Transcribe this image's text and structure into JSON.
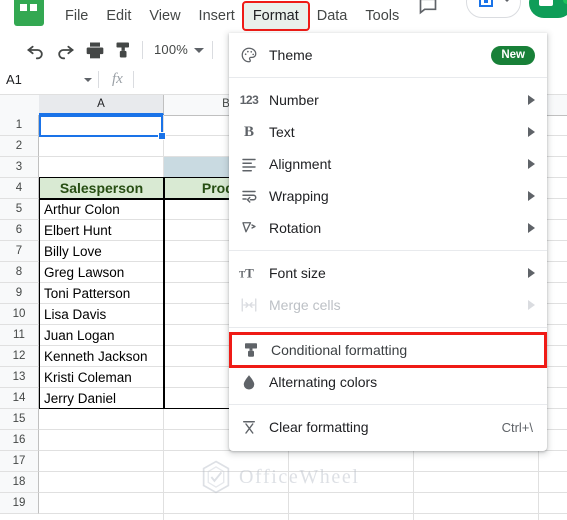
{
  "app": {
    "logo_icon": "sheets-logo-icon",
    "menubar": [
      {
        "label": "File"
      },
      {
        "label": "Edit"
      },
      {
        "label": "View"
      },
      {
        "label": "Insert"
      },
      {
        "label": "Format"
      },
      {
        "label": "Data"
      },
      {
        "label": "Tools"
      }
    ],
    "active_menu": "Format"
  },
  "topright": {
    "comment_icon": "comment-icon",
    "present_icon": "present-icon",
    "present_caret_icon": "chevron-down-icon",
    "share_icon": "share-lock-icon"
  },
  "toolbar": {
    "undo_icon": "undo-icon",
    "redo_icon": "redo-icon",
    "print_icon": "print-icon",
    "paint_format_icon": "paint-format-icon",
    "zoom_value": "100%",
    "zoom_caret_icon": "chevron-down-icon"
  },
  "formulabar": {
    "name_box_value": "A1",
    "name_box_caret_icon": "chevron-down-icon",
    "fx_label": "fx",
    "formula_value": ""
  },
  "grid": {
    "columns": [
      {
        "label": "A",
        "selected": true
      },
      {
        "label": "B",
        "selected": false
      }
    ],
    "rows": [
      "1",
      "2",
      "3",
      "4",
      "5",
      "6",
      "7",
      "8",
      "9",
      "10",
      "11",
      "12",
      "13",
      "14",
      "15",
      "16",
      "17",
      "18",
      "19"
    ],
    "header_a": "Salesperson",
    "header_b": "Produc",
    "names": [
      "Arthur Colon",
      "Elbert Hunt",
      "Billy Love",
      "Greg Lawson",
      "Toni Patterson",
      "Lisa Davis",
      "Juan Logan",
      "Kenneth Jackson",
      "Kristi Coleman",
      "Jerry Daniel"
    ],
    "selected_cell": "A1"
  },
  "format_menu": {
    "items": [
      {
        "icon": "palette-icon",
        "label": "Theme",
        "badge": "New",
        "submenu": false,
        "accel": "",
        "disabled": false,
        "highlighted": false
      },
      {
        "icon": "number-123-icon",
        "label": "Number",
        "badge": "",
        "submenu": true,
        "accel": "",
        "disabled": false,
        "highlighted": false
      },
      {
        "icon": "bold-text-icon",
        "label": "Text",
        "badge": "",
        "submenu": true,
        "accel": "",
        "disabled": false,
        "highlighted": false
      },
      {
        "icon": "alignment-icon",
        "label": "Alignment",
        "badge": "",
        "submenu": true,
        "accel": "",
        "disabled": false,
        "highlighted": false
      },
      {
        "icon": "wrapping-icon",
        "label": "Wrapping",
        "badge": "",
        "submenu": true,
        "accel": "",
        "disabled": false,
        "highlighted": false
      },
      {
        "icon": "rotation-icon",
        "label": "Rotation",
        "badge": "",
        "submenu": true,
        "accel": "",
        "disabled": false,
        "highlighted": false
      },
      {
        "icon": "font-size-icon",
        "label": "Font size",
        "badge": "",
        "submenu": true,
        "accel": "",
        "disabled": false,
        "highlighted": false
      },
      {
        "icon": "merge-cells-icon",
        "label": "Merge cells",
        "badge": "",
        "submenu": true,
        "accel": "",
        "disabled": true,
        "highlighted": false
      },
      {
        "icon": "conditional-formatting-icon",
        "label": "Conditional formatting",
        "badge": "",
        "submenu": false,
        "accel": "",
        "disabled": false,
        "highlighted": true
      },
      {
        "icon": "alternating-colors-icon",
        "label": "Alternating colors",
        "badge": "",
        "submenu": false,
        "accel": "",
        "disabled": false,
        "highlighted": false
      },
      {
        "icon": "clear-formatting-icon",
        "label": "Clear formatting",
        "badge": "",
        "submenu": false,
        "accel": "Ctrl+\\",
        "disabled": false,
        "highlighted": false
      }
    ]
  },
  "watermark": {
    "text": "OfficeWheel",
    "logo_icon": "officewheel-hex-icon"
  },
  "colors": {
    "highlight_red": "#ef1b16",
    "sheets_green": "#33a852",
    "badge_green": "#188038",
    "header_green_bg": "#d9ead3",
    "header_green_text": "#274e13",
    "blue_bar": "#c9dae1",
    "selection_blue": "#1a73e8"
  }
}
